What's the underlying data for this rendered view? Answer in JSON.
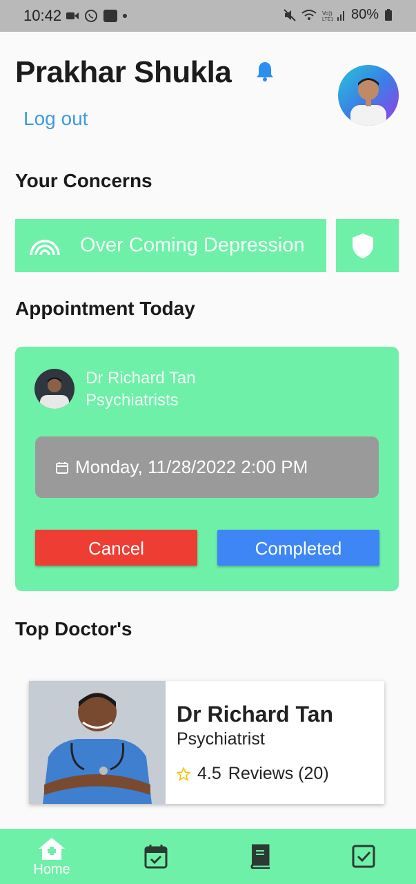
{
  "status_bar": {
    "time": "10:42",
    "battery": "80%"
  },
  "header": {
    "user_name": "Prakhar Shukla",
    "logout_label": "Log out"
  },
  "concerns": {
    "title": "Your Concerns",
    "items": [
      {
        "label": "Over Coming Depression",
        "icon": "rainbow-icon"
      },
      {
        "label": "",
        "icon": "shield-icon"
      }
    ]
  },
  "appointment": {
    "title": "Appointment Today",
    "doctor_name": "Dr Richard Tan",
    "doctor_specialty": "Psychiatrists",
    "datetime": "Monday, 11/28/2022 2:00 PM",
    "cancel_label": "Cancel",
    "completed_label": "Completed"
  },
  "top_doctors": {
    "title": "Top Doctor's",
    "items": [
      {
        "name": "Dr Richard Tan",
        "specialty": "Psychiatrist",
        "rating": "4.5",
        "reviews_label": "Reviews (20)"
      }
    ]
  },
  "bottom_nav": {
    "items": [
      {
        "label": "Home",
        "icon": "home-icon",
        "active": true
      },
      {
        "label": "",
        "icon": "calendar-check-icon",
        "active": false
      },
      {
        "label": "",
        "icon": "book-icon",
        "active": false
      },
      {
        "label": "",
        "icon": "checkbox-icon",
        "active": false
      }
    ]
  },
  "colors": {
    "accent_green": "#6ef0a8",
    "cancel_red": "#ee3d33",
    "completed_blue": "#3e86f5",
    "link_blue": "#3d9be0",
    "date_gray": "#9a9a9a"
  }
}
